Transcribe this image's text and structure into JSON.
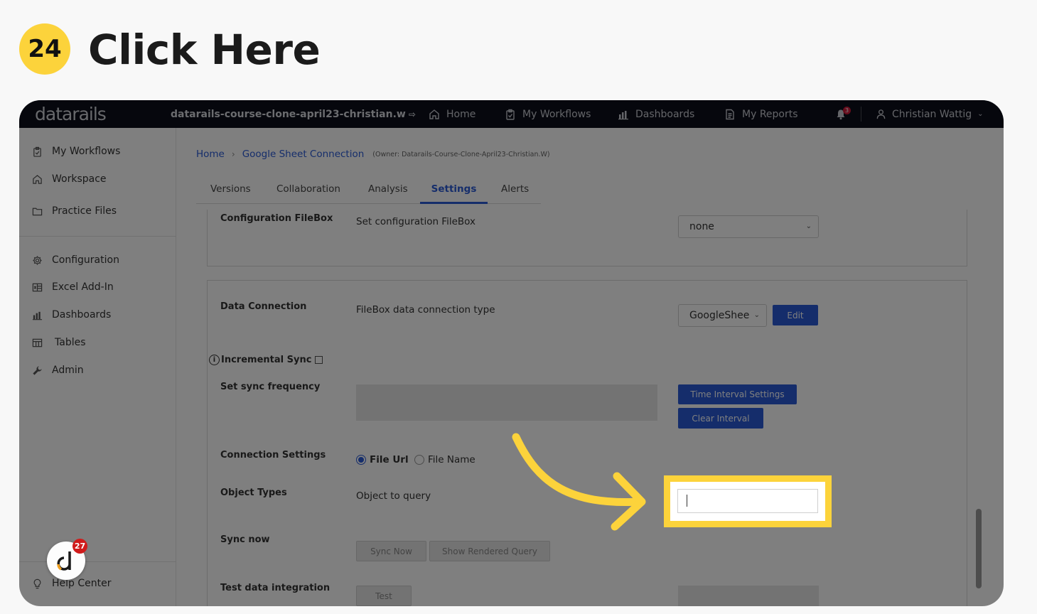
{
  "step": {
    "number": "24",
    "title": "Click Here"
  },
  "topnav": {
    "logo": "datarails",
    "workspace": "datarails-course-clone-april23-christian.w",
    "items": [
      {
        "label": "Home",
        "icon": "home-icon"
      },
      {
        "label": "My Workflows",
        "icon": "clipboard-icon"
      },
      {
        "label": "Dashboards",
        "icon": "bar-chart-icon"
      },
      {
        "label": "My Reports",
        "icon": "document-icon"
      }
    ],
    "notification_count": "3",
    "user_name": "Christian Wattig"
  },
  "sidebar": {
    "items_top": [
      {
        "label": "My Workflows",
        "icon": "clipboard-icon"
      },
      {
        "label": "Workspace",
        "icon": "home-icon"
      },
      {
        "label": "Practice Files",
        "icon": "folder-icon"
      }
    ],
    "items_bottom": [
      {
        "label": "Configuration",
        "icon": "gear-icon"
      },
      {
        "label": "Excel Add-In",
        "icon": "excel-icon"
      },
      {
        "label": "Dashboards",
        "icon": "bar-chart-icon"
      },
      {
        "label": "Tables",
        "icon": "table-icon"
      },
      {
        "label": "Admin",
        "icon": "wrench-icon"
      }
    ],
    "help_center": "Help Center",
    "help_badge": "27"
  },
  "breadcrumb": {
    "home": "Home",
    "current": "Google Sheet Connection",
    "owner": "(Owner: Datarails-Course-Clone-April23-Christian.W)"
  },
  "tabs": [
    {
      "label": "Versions"
    },
    {
      "label": "Collaboration"
    },
    {
      "label": "Analysis"
    },
    {
      "label": "Settings",
      "active": true
    },
    {
      "label": "Alerts"
    }
  ],
  "config_filebox": {
    "label": "Configuration FileBox",
    "description": "Set configuration FileBox",
    "selected": "none"
  },
  "data_connection": {
    "label": "Data Connection",
    "description": "FileBox data connection type",
    "selected": "GoogleShee",
    "edit_button": "Edit",
    "incremental_sync": "Incremental Sync",
    "sync_frequency_label": "Set sync frequency",
    "time_interval_button": "Time Interval Settings",
    "clear_interval_button": "Clear Interval",
    "connection_settings_label": "Connection Settings",
    "radio_file_url": "File Url",
    "radio_file_name": "File Name",
    "object_types_label": "Object Types",
    "object_types_description": "Object to query",
    "sync_now_label": "Sync now",
    "sync_now_button": "Sync Now",
    "show_query_button": "Show Rendered Query",
    "test_label": "Test data integration",
    "test_button": "Test"
  },
  "colors": {
    "accent": "#2a5bd7",
    "highlight": "#fcd33b",
    "nav_bg": "#0c0f1a"
  }
}
